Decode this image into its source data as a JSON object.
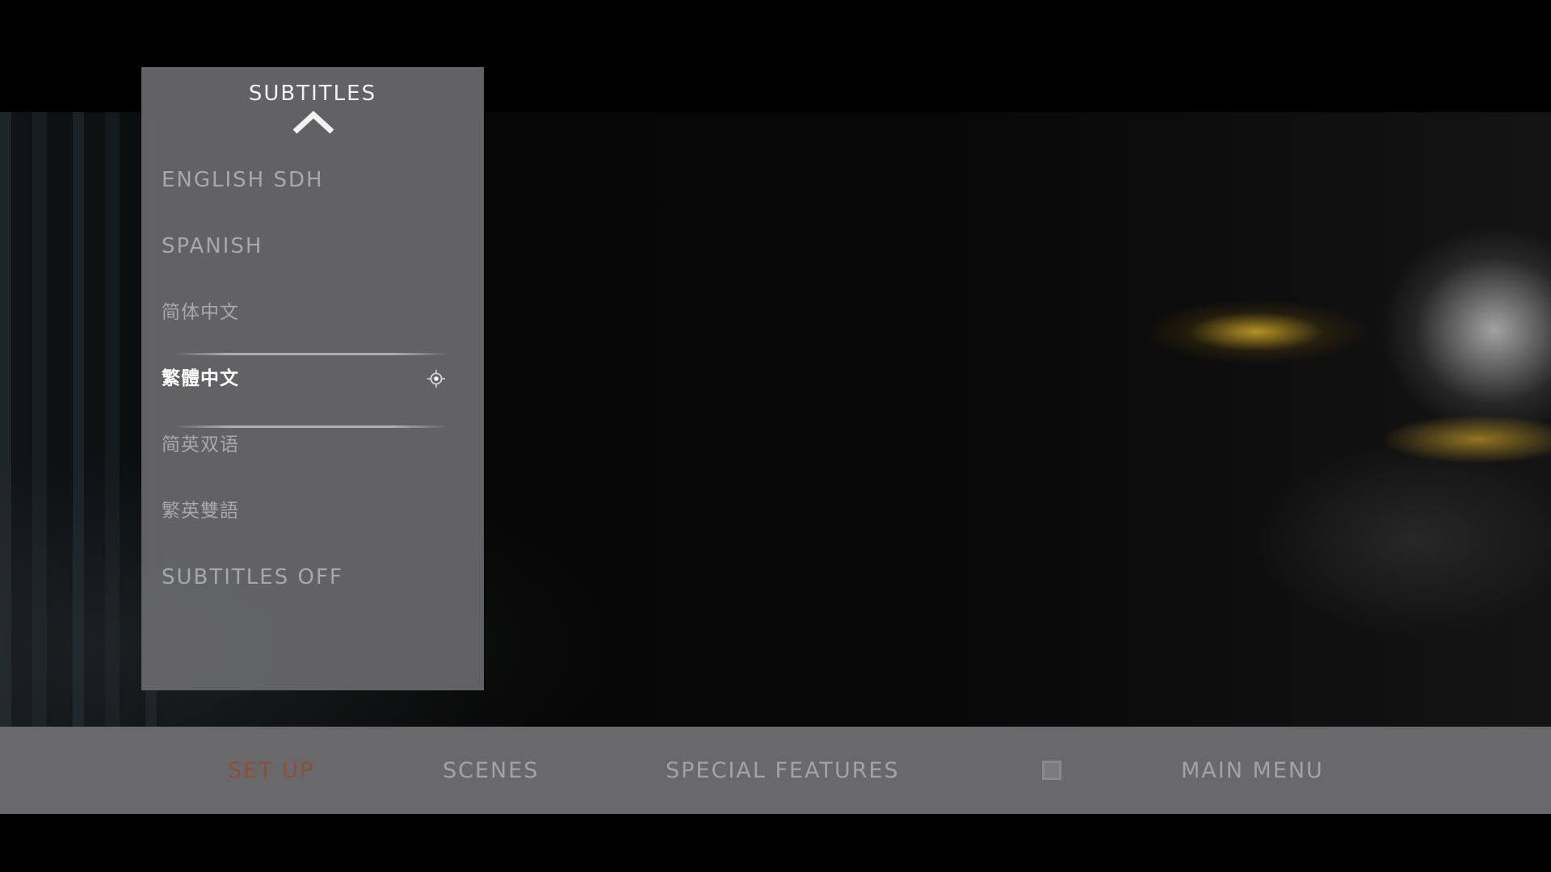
{
  "panel": {
    "title": "SUBTITLES",
    "items": [
      {
        "label": "ENGLISH SDH"
      },
      {
        "label": "SPANISH"
      },
      {
        "label": "简体中文"
      },
      {
        "label": "繁體中文",
        "selected": true
      },
      {
        "label": "简英双语"
      },
      {
        "label": "繁英雙語"
      },
      {
        "label": "SUBTITLES OFF"
      }
    ]
  },
  "navbar": {
    "items": [
      {
        "label": "SET UP",
        "active": true
      },
      {
        "label": "SCENES"
      },
      {
        "label": "SPECIAL FEATURES"
      },
      {
        "label": "MAIN MENU"
      }
    ],
    "stop_icon": "stop-icon"
  },
  "colors": {
    "panel_bg": "#666668",
    "navbar_bg": "#69696b",
    "active_nav": "#8a5038",
    "item_text": "#a8a8aa",
    "selected_text": "#ffffff"
  }
}
